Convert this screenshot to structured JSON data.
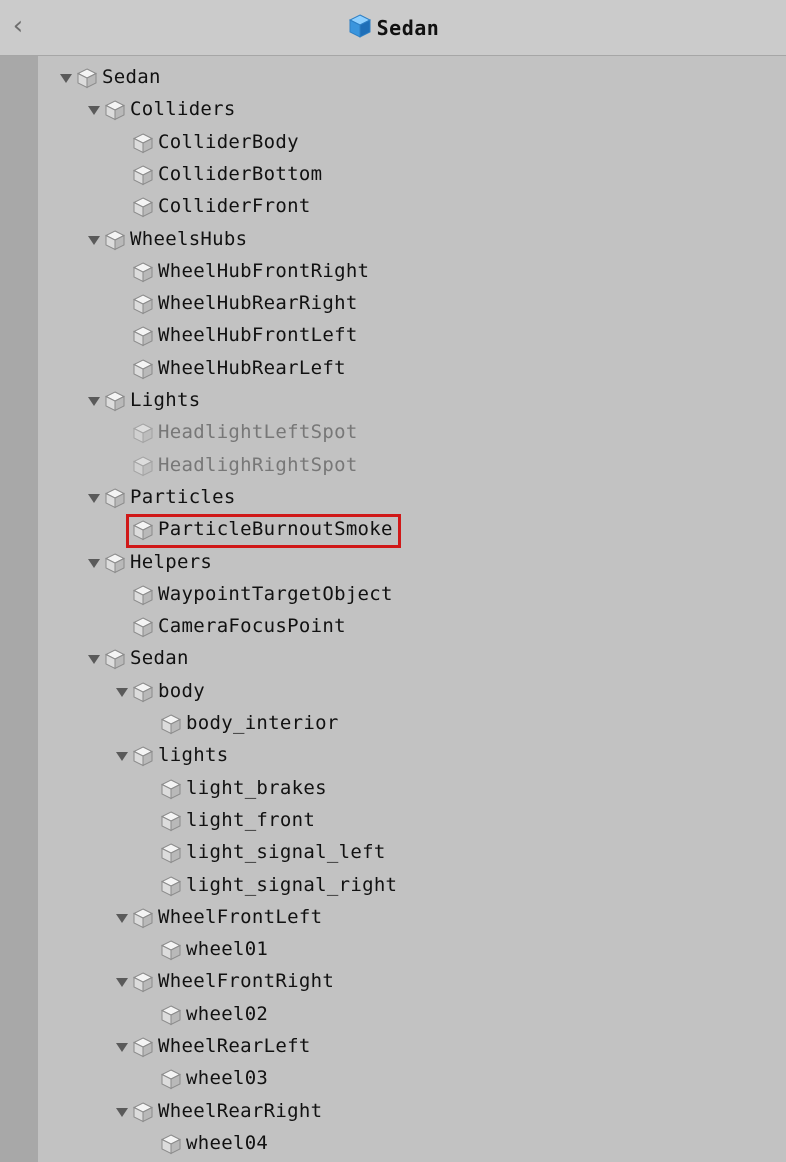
{
  "header": {
    "back_icon": "chevron-left-icon",
    "title": "Sedan",
    "title_icon": "prefab-cube-icon",
    "accent": "#4aa4e6"
  },
  "tree": {
    "rows": [
      {
        "label": "Sedan",
        "depth": 0,
        "expanded": true,
        "active": true
      },
      {
        "label": "Colliders",
        "depth": 1,
        "expanded": true,
        "active": true
      },
      {
        "label": "ColliderBody",
        "depth": 2,
        "expanded": null,
        "active": true
      },
      {
        "label": "ColliderBottom",
        "depth": 2,
        "expanded": null,
        "active": true
      },
      {
        "label": "ColliderFront",
        "depth": 2,
        "expanded": null,
        "active": true
      },
      {
        "label": "WheelsHubs",
        "depth": 1,
        "expanded": true,
        "active": true
      },
      {
        "label": "WheelHubFrontRight",
        "depth": 2,
        "expanded": null,
        "active": true
      },
      {
        "label": "WheelHubRearRight",
        "depth": 2,
        "expanded": null,
        "active": true
      },
      {
        "label": "WheelHubFrontLeft",
        "depth": 2,
        "expanded": null,
        "active": true
      },
      {
        "label": "WheelHubRearLeft",
        "depth": 2,
        "expanded": null,
        "active": true
      },
      {
        "label": "Lights",
        "depth": 1,
        "expanded": true,
        "active": true
      },
      {
        "label": "HeadlightLeftSpot",
        "depth": 2,
        "expanded": null,
        "active": false
      },
      {
        "label": "HeadlighRightSpot",
        "depth": 2,
        "expanded": null,
        "active": false
      },
      {
        "label": "Particles",
        "depth": 1,
        "expanded": true,
        "active": true
      },
      {
        "label": "ParticleBurnoutSmoke",
        "depth": 2,
        "expanded": null,
        "active": true,
        "highlighted": true
      },
      {
        "label": "Helpers",
        "depth": 1,
        "expanded": true,
        "active": true
      },
      {
        "label": "WaypointTargetObject",
        "depth": 2,
        "expanded": null,
        "active": true
      },
      {
        "label": "CameraFocusPoint",
        "depth": 2,
        "expanded": null,
        "active": true
      },
      {
        "label": "Sedan",
        "depth": 1,
        "expanded": true,
        "active": true
      },
      {
        "label": "body",
        "depth": 2,
        "expanded": true,
        "active": true
      },
      {
        "label": "body_interior",
        "depth": 3,
        "expanded": null,
        "active": true
      },
      {
        "label": "lights",
        "depth": 2,
        "expanded": true,
        "active": true
      },
      {
        "label": "light_brakes",
        "depth": 3,
        "expanded": null,
        "active": true
      },
      {
        "label": "light_front",
        "depth": 3,
        "expanded": null,
        "active": true
      },
      {
        "label": "light_signal_left",
        "depth": 3,
        "expanded": null,
        "active": true
      },
      {
        "label": "light_signal_right",
        "depth": 3,
        "expanded": null,
        "active": true
      },
      {
        "label": "WheelFrontLeft",
        "depth": 2,
        "expanded": true,
        "active": true
      },
      {
        "label": "wheel01",
        "depth": 3,
        "expanded": null,
        "active": true
      },
      {
        "label": "WheelFrontRight",
        "depth": 2,
        "expanded": true,
        "active": true
      },
      {
        "label": "wheel02",
        "depth": 3,
        "expanded": null,
        "active": true
      },
      {
        "label": "WheelRearLeft",
        "depth": 2,
        "expanded": true,
        "active": true
      },
      {
        "label": "wheel03",
        "depth": 3,
        "expanded": null,
        "active": true
      },
      {
        "label": "WheelRearRight",
        "depth": 2,
        "expanded": true,
        "active": true
      },
      {
        "label": "wheel04",
        "depth": 3,
        "expanded": null,
        "active": true
      }
    ],
    "row_icon": "gameobject-cube-icon",
    "expand_icon": "triangle-down-icon",
    "highlight_color": "#d01818"
  }
}
